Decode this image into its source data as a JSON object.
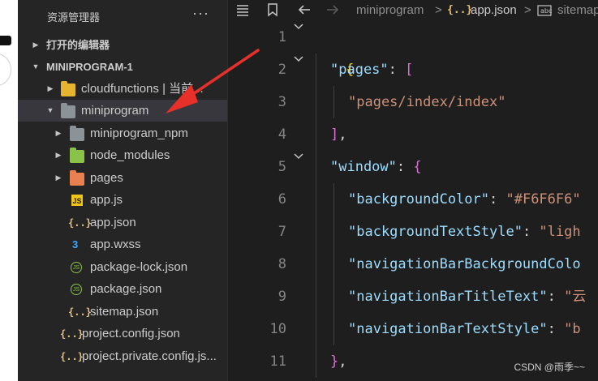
{
  "explorer": {
    "title": "资源管理器",
    "more": "···",
    "open_editors": "打开的编辑器",
    "root": "MINIPROGRAM-1",
    "items": [
      {
        "label": "cloudfunctions | 当前..."
      },
      {
        "label": "miniprogram"
      },
      {
        "label": "miniprogram_npm"
      },
      {
        "label": "node_modules"
      },
      {
        "label": "pages"
      },
      {
        "label": "app.js"
      },
      {
        "label": "app.json"
      },
      {
        "label": "app.wxss"
      },
      {
        "label": "package-lock.json"
      },
      {
        "label": "package.json"
      },
      {
        "label": "sitemap.json"
      },
      {
        "label": "project.config.json"
      },
      {
        "label": "project.private.config.js..."
      }
    ],
    "icon_glyphs": {
      "js": "JS",
      "json": "{..}",
      "css": "3",
      "node": "JS"
    }
  },
  "breadcrumb": {
    "segments": [
      "miniprogram",
      "app.json",
      "sitemap"
    ],
    "sep": ">"
  },
  "editor": {
    "line_numbers": [
      "1",
      "2",
      "3",
      "4",
      "5",
      "6",
      "7",
      "8",
      "9",
      "10",
      "11"
    ],
    "lines": [
      {
        "t1": "{"
      },
      {
        "k": "\"pages\"",
        "p": ": ",
        "t2": "["
      },
      {
        "s": "\"pages/index/index\""
      },
      {
        "t2": "]",
        "p": ","
      },
      {
        "k": "\"window\"",
        "p": ": ",
        "t2": "{"
      },
      {
        "k": "\"backgroundColor\"",
        "p": ": ",
        "s": "\"#F6F6F6\""
      },
      {
        "k": "\"backgroundTextStyle\"",
        "p": ": ",
        "s": "\"ligh"
      },
      {
        "k": "\"navigationBarBackgroundColo"
      },
      {
        "k": "\"navigationBarTitleText\"",
        "p": ": ",
        "s": "\"云"
      },
      {
        "k": "\"navigationBarTextStyle\"",
        "p": ": ",
        "s": "\"b"
      },
      {
        "t2": "}",
        "p": ","
      }
    ]
  },
  "watermark": "CSDN @雨季~~",
  "colors": {
    "key": "#9cdcfe",
    "string": "#ce9178",
    "bracket_level1": "#ffd700",
    "bracket_level2": "#da70d6",
    "arrow": "#e8302a",
    "selected_row": "#37373d"
  }
}
